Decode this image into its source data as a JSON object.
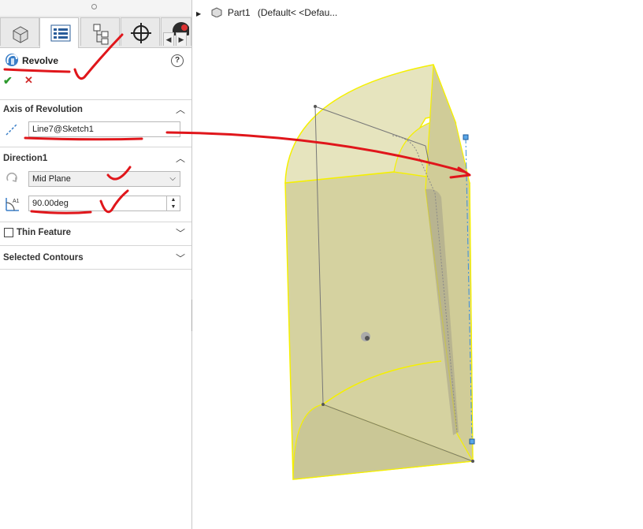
{
  "feature": {
    "title": "Revolve",
    "help_symbol": "?",
    "ok_symbol": "✔",
    "cancel_symbol": "✕"
  },
  "axis_section": {
    "title": "Axis of Revolution",
    "axis_value": "Line7@Sketch1"
  },
  "direction_section": {
    "title": "Direction1",
    "end_condition": "Mid Plane",
    "angle_value": "90.00deg"
  },
  "thin_feature": {
    "label": "Thin Feature",
    "checked": false
  },
  "contours_section": {
    "title": "Selected Contours"
  },
  "tree": {
    "part_label": "Part1",
    "config_label": "(Default< <Defau..."
  },
  "colors": {
    "solid_fill": "#d5d2a0",
    "edge_highlight": "#f5f000",
    "annotation_red": "#e0161b",
    "axis_line": "#3a8fd8"
  }
}
